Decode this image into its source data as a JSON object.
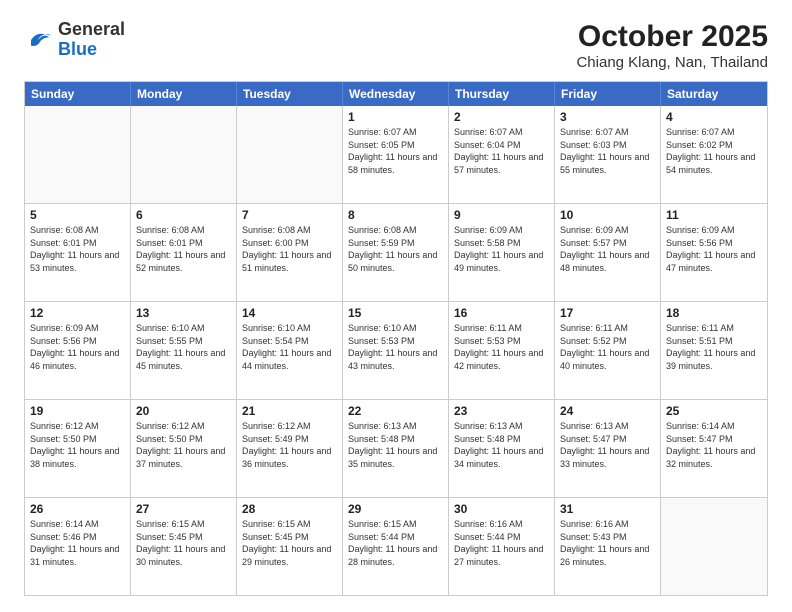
{
  "header": {
    "logo": {
      "general": "General",
      "blue": "Blue"
    },
    "title": "October 2025",
    "location": "Chiang Klang, Nan, Thailand"
  },
  "weekdays": [
    "Sunday",
    "Monday",
    "Tuesday",
    "Wednesday",
    "Thursday",
    "Friday",
    "Saturday"
  ],
  "weeks": [
    [
      {
        "day": "",
        "empty": true
      },
      {
        "day": "",
        "empty": true
      },
      {
        "day": "",
        "empty": true
      },
      {
        "day": "1",
        "sunrise": "6:07 AM",
        "sunset": "6:05 PM",
        "daylight": "11 hours and 58 minutes."
      },
      {
        "day": "2",
        "sunrise": "6:07 AM",
        "sunset": "6:04 PM",
        "daylight": "11 hours and 57 minutes."
      },
      {
        "day": "3",
        "sunrise": "6:07 AM",
        "sunset": "6:03 PM",
        "daylight": "11 hours and 55 minutes."
      },
      {
        "day": "4",
        "sunrise": "6:07 AM",
        "sunset": "6:02 PM",
        "daylight": "11 hours and 54 minutes."
      }
    ],
    [
      {
        "day": "5",
        "sunrise": "6:08 AM",
        "sunset": "6:01 PM",
        "daylight": "11 hours and 53 minutes."
      },
      {
        "day": "6",
        "sunrise": "6:08 AM",
        "sunset": "6:01 PM",
        "daylight": "11 hours and 52 minutes."
      },
      {
        "day": "7",
        "sunrise": "6:08 AM",
        "sunset": "6:00 PM",
        "daylight": "11 hours and 51 minutes."
      },
      {
        "day": "8",
        "sunrise": "6:08 AM",
        "sunset": "5:59 PM",
        "daylight": "11 hours and 50 minutes."
      },
      {
        "day": "9",
        "sunrise": "6:09 AM",
        "sunset": "5:58 PM",
        "daylight": "11 hours and 49 minutes."
      },
      {
        "day": "10",
        "sunrise": "6:09 AM",
        "sunset": "5:57 PM",
        "daylight": "11 hours and 48 minutes."
      },
      {
        "day": "11",
        "sunrise": "6:09 AM",
        "sunset": "5:56 PM",
        "daylight": "11 hours and 47 minutes."
      }
    ],
    [
      {
        "day": "12",
        "sunrise": "6:09 AM",
        "sunset": "5:56 PM",
        "daylight": "11 hours and 46 minutes."
      },
      {
        "day": "13",
        "sunrise": "6:10 AM",
        "sunset": "5:55 PM",
        "daylight": "11 hours and 45 minutes."
      },
      {
        "day": "14",
        "sunrise": "6:10 AM",
        "sunset": "5:54 PM",
        "daylight": "11 hours and 44 minutes."
      },
      {
        "day": "15",
        "sunrise": "6:10 AM",
        "sunset": "5:53 PM",
        "daylight": "11 hours and 43 minutes."
      },
      {
        "day": "16",
        "sunrise": "6:11 AM",
        "sunset": "5:53 PM",
        "daylight": "11 hours and 42 minutes."
      },
      {
        "day": "17",
        "sunrise": "6:11 AM",
        "sunset": "5:52 PM",
        "daylight": "11 hours and 40 minutes."
      },
      {
        "day": "18",
        "sunrise": "6:11 AM",
        "sunset": "5:51 PM",
        "daylight": "11 hours and 39 minutes."
      }
    ],
    [
      {
        "day": "19",
        "sunrise": "6:12 AM",
        "sunset": "5:50 PM",
        "daylight": "11 hours and 38 minutes."
      },
      {
        "day": "20",
        "sunrise": "6:12 AM",
        "sunset": "5:50 PM",
        "daylight": "11 hours and 37 minutes."
      },
      {
        "day": "21",
        "sunrise": "6:12 AM",
        "sunset": "5:49 PM",
        "daylight": "11 hours and 36 minutes."
      },
      {
        "day": "22",
        "sunrise": "6:13 AM",
        "sunset": "5:48 PM",
        "daylight": "11 hours and 35 minutes."
      },
      {
        "day": "23",
        "sunrise": "6:13 AM",
        "sunset": "5:48 PM",
        "daylight": "11 hours and 34 minutes."
      },
      {
        "day": "24",
        "sunrise": "6:13 AM",
        "sunset": "5:47 PM",
        "daylight": "11 hours and 33 minutes."
      },
      {
        "day": "25",
        "sunrise": "6:14 AM",
        "sunset": "5:47 PM",
        "daylight": "11 hours and 32 minutes."
      }
    ],
    [
      {
        "day": "26",
        "sunrise": "6:14 AM",
        "sunset": "5:46 PM",
        "daylight": "11 hours and 31 minutes."
      },
      {
        "day": "27",
        "sunrise": "6:15 AM",
        "sunset": "5:45 PM",
        "daylight": "11 hours and 30 minutes."
      },
      {
        "day": "28",
        "sunrise": "6:15 AM",
        "sunset": "5:45 PM",
        "daylight": "11 hours and 29 minutes."
      },
      {
        "day": "29",
        "sunrise": "6:15 AM",
        "sunset": "5:44 PM",
        "daylight": "11 hours and 28 minutes."
      },
      {
        "day": "30",
        "sunrise": "6:16 AM",
        "sunset": "5:44 PM",
        "daylight": "11 hours and 27 minutes."
      },
      {
        "day": "31",
        "sunrise": "6:16 AM",
        "sunset": "5:43 PM",
        "daylight": "11 hours and 26 minutes."
      },
      {
        "day": "",
        "empty": true
      }
    ]
  ]
}
